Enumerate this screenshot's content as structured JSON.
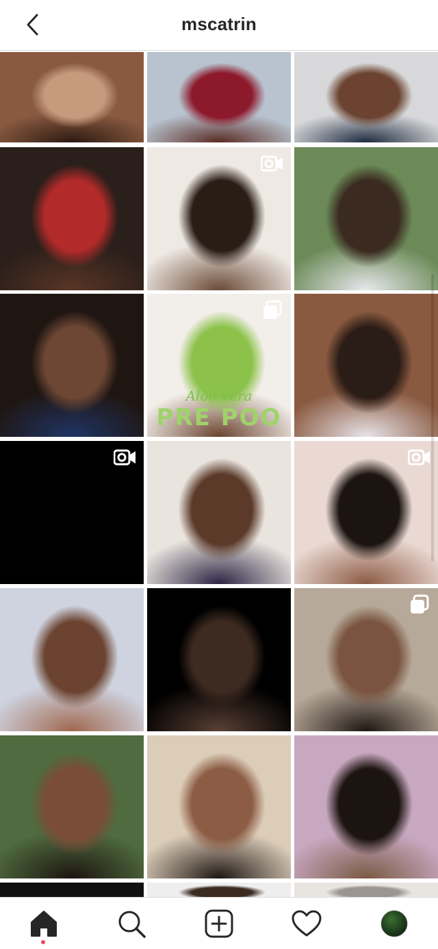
{
  "header": {
    "title": "mscatrin"
  },
  "grid": {
    "tiles": [
      {
        "name": "post-1-1",
        "type": "image",
        "colors": [
          "#8a5a40",
          "#c59a7d",
          "#2c1a12"
        ]
      },
      {
        "name": "post-1-2",
        "type": "image",
        "colors": [
          "#b8c3cf",
          "#8d1a2c",
          "#5a2a22"
        ]
      },
      {
        "name": "post-1-3",
        "type": "image",
        "colors": [
          "#d8d8da",
          "#6b4330",
          "#1d2a3f"
        ]
      },
      {
        "name": "post-2-1",
        "type": "image",
        "colors": [
          "#2a1f1a",
          "#b32a2a",
          "#5a3526"
        ]
      },
      {
        "name": "post-2-2",
        "type": "video",
        "colors": [
          "#efe9e4",
          "#2a1d16",
          "#6b4a36"
        ]
      },
      {
        "name": "post-2-3",
        "type": "image",
        "colors": [
          "#6b8a57",
          "#3a2a20",
          "#e8e8ee"
        ]
      },
      {
        "name": "post-3-1",
        "type": "image",
        "colors": [
          "#1f1612",
          "#6e4734",
          "#1f3466"
        ]
      },
      {
        "name": "post-3-2",
        "type": "carousel",
        "colors": [
          "#f2eee9",
          "#8cc24a",
          "#6b4330"
        ],
        "overlay_script": "Aloe Vera",
        "overlay_text": "PRE POO"
      },
      {
        "name": "post-3-3",
        "type": "image",
        "colors": [
          "#8a5a40",
          "#2a1c16",
          "#e8e4ea"
        ]
      },
      {
        "name": "post-4-1",
        "type": "video",
        "colors": [
          "#000000",
          "#000000",
          "#000000"
        ]
      },
      {
        "name": "post-4-2",
        "type": "image",
        "colors": [
          "#e9e4de",
          "#5b3a2a",
          "#2b2342"
        ]
      },
      {
        "name": "post-4-3",
        "type": "video",
        "colors": [
          "#ead9d3",
          "#1b1410",
          "#8c5a44"
        ]
      },
      {
        "name": "post-5-1",
        "type": "image",
        "colors": [
          "#cfd3df",
          "#6b4330",
          "#a06850"
        ]
      },
      {
        "name": "post-5-2",
        "type": "image",
        "colors": [
          "#000000",
          "#3d2a20",
          "#5a4034"
        ]
      },
      {
        "name": "post-5-3",
        "type": "carousel",
        "colors": [
          "#b7a999",
          "#7a5440",
          "#1d1612"
        ]
      },
      {
        "name": "post-6-1",
        "type": "image",
        "colors": [
          "#4f6b3f",
          "#7a4d38",
          "#1c1410"
        ]
      },
      {
        "name": "post-6-2",
        "type": "image",
        "colors": [
          "#dccdb9",
          "#8c5c44",
          "#1d1612"
        ]
      },
      {
        "name": "post-6-3",
        "type": "image",
        "colors": [
          "#c8a8c0",
          "#1b1410",
          "#7a5a44"
        ]
      },
      {
        "name": "post-7-1",
        "type": "image",
        "colors": [
          "#111111",
          "#111111",
          "#111111"
        ]
      },
      {
        "name": "post-7-2",
        "type": "image",
        "colors": [
          "#eeeeee",
          "#3a2a20",
          "#d8d0c8"
        ]
      },
      {
        "name": "post-7-3",
        "type": "image",
        "colors": [
          "#e8e4e0",
          "#9a9590",
          "#6b4a36"
        ]
      }
    ]
  },
  "nav": {
    "items": [
      {
        "name": "home-icon",
        "active": true
      },
      {
        "name": "search-icon",
        "active": false
      },
      {
        "name": "new-post-icon",
        "active": false
      },
      {
        "name": "activity-heart-icon",
        "active": false
      },
      {
        "name": "profile-avatar",
        "active": false
      }
    ],
    "notification_color": "#ed4956"
  }
}
